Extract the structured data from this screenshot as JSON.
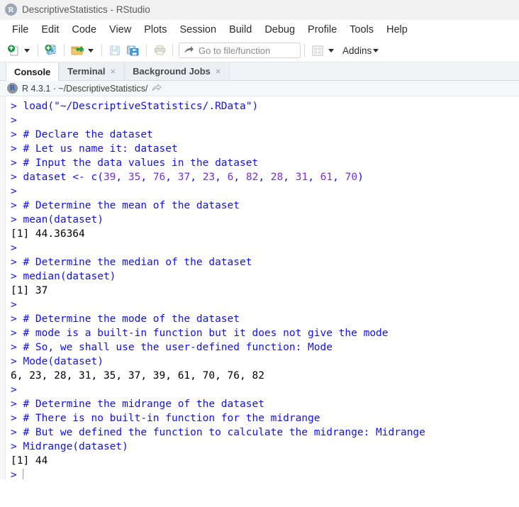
{
  "window": {
    "title": "DescriptiveStatistics - RStudio",
    "logo_letter": "R",
    "logo_icon": "rstudio-logo-icon"
  },
  "menubar": {
    "items": [
      {
        "label": "File"
      },
      {
        "label": "Edit"
      },
      {
        "label": "Code"
      },
      {
        "label": "View"
      },
      {
        "label": "Plots"
      },
      {
        "label": "Session"
      },
      {
        "label": "Build"
      },
      {
        "label": "Debug"
      },
      {
        "label": "Profile"
      },
      {
        "label": "Tools"
      },
      {
        "label": "Help"
      }
    ]
  },
  "toolbar": {
    "new_file_icon": "new-file-icon",
    "new_file_dropdown": "chevron-down-icon",
    "new_project_icon": "new-project-icon",
    "open_file_icon": "open-folder-icon",
    "open_file_dropdown": "chevron-down-icon",
    "save_icon": "save-icon",
    "save_all_icon": "save-all-icon",
    "print_icon": "print-icon",
    "goto_icon": "goto-arrow-icon",
    "goto_placeholder": "Go to file/function",
    "panes_icon": "workspace-panes-icon",
    "panes_dropdown": "chevron-down-icon",
    "addins_label": "Addins",
    "addins_dropdown": "chevron-down-icon"
  },
  "tabs": [
    {
      "label": "Console",
      "active": true,
      "closable": false,
      "close_glyph": ""
    },
    {
      "label": "Terminal",
      "active": false,
      "closable": true,
      "close_glyph": "×"
    },
    {
      "label": "Background Jobs",
      "active": false,
      "closable": true,
      "close_glyph": "×"
    }
  ],
  "session": {
    "badge_letter": "R",
    "text": "R 4.3.1  ·  ~/DescriptiveStatistics/",
    "arrow_icon": "open-in-new-window-icon"
  },
  "console": {
    "prompt": "> ",
    "cursor": "text-cursor",
    "lines": [
      {
        "type": "input",
        "segments": [
          {
            "t": "> load(\"~/DescriptiveStatistics/.RData\")",
            "k": "in"
          }
        ]
      },
      {
        "type": "input",
        "segments": [
          {
            "t": "> ",
            "k": "in"
          }
        ]
      },
      {
        "type": "input",
        "segments": [
          {
            "t": "> # Declare the dataset",
            "k": "in"
          }
        ]
      },
      {
        "type": "input",
        "segments": [
          {
            "t": "> # Let us name it: dataset",
            "k": "in"
          }
        ]
      },
      {
        "type": "input",
        "segments": [
          {
            "t": "> # Input the data values in the dataset",
            "k": "in"
          }
        ]
      },
      {
        "type": "input",
        "segments": [
          {
            "t": "> dataset <- c(",
            "k": "in"
          },
          {
            "t": "39",
            "k": "num"
          },
          {
            "t": ", ",
            "k": "in"
          },
          {
            "t": "35",
            "k": "num"
          },
          {
            "t": ", ",
            "k": "in"
          },
          {
            "t": "76",
            "k": "num"
          },
          {
            "t": ", ",
            "k": "in"
          },
          {
            "t": "37",
            "k": "num"
          },
          {
            "t": ", ",
            "k": "in"
          },
          {
            "t": "23",
            "k": "num"
          },
          {
            "t": ", ",
            "k": "in"
          },
          {
            "t": "6",
            "k": "num"
          },
          {
            "t": ", ",
            "k": "in"
          },
          {
            "t": "82",
            "k": "num"
          },
          {
            "t": ", ",
            "k": "in"
          },
          {
            "t": "28",
            "k": "num"
          },
          {
            "t": ", ",
            "k": "in"
          },
          {
            "t": "31",
            "k": "num"
          },
          {
            "t": ", ",
            "k": "in"
          },
          {
            "t": "61",
            "k": "num"
          },
          {
            "t": ", ",
            "k": "in"
          },
          {
            "t": "70",
            "k": "num"
          },
          {
            "t": ")",
            "k": "in"
          }
        ]
      },
      {
        "type": "input",
        "segments": [
          {
            "t": "> ",
            "k": "in"
          }
        ]
      },
      {
        "type": "input",
        "segments": [
          {
            "t": "> # Determine the mean of the dataset",
            "k": "in"
          }
        ]
      },
      {
        "type": "input",
        "segments": [
          {
            "t": "> mean(dataset)",
            "k": "in"
          }
        ]
      },
      {
        "type": "output",
        "segments": [
          {
            "t": "[1] 44.36364",
            "k": "out"
          }
        ]
      },
      {
        "type": "input",
        "segments": [
          {
            "t": "> ",
            "k": "in"
          }
        ]
      },
      {
        "type": "input",
        "segments": [
          {
            "t": "> # Determine the median of the dataset",
            "k": "in"
          }
        ]
      },
      {
        "type": "input",
        "segments": [
          {
            "t": "> median(dataset)",
            "k": "in"
          }
        ]
      },
      {
        "type": "output",
        "segments": [
          {
            "t": "[1] 37",
            "k": "out"
          }
        ]
      },
      {
        "type": "input",
        "segments": [
          {
            "t": "> ",
            "k": "in"
          }
        ]
      },
      {
        "type": "input",
        "segments": [
          {
            "t": "> # Determine the mode of the dataset",
            "k": "in"
          }
        ]
      },
      {
        "type": "input",
        "segments": [
          {
            "t": "> # mode is a built-in function but it does not give the mode",
            "k": "in"
          }
        ]
      },
      {
        "type": "input",
        "segments": [
          {
            "t": "> # So, we shall use the user-defined function: Mode",
            "k": "in"
          }
        ]
      },
      {
        "type": "input",
        "segments": [
          {
            "t": "> Mode(dataset)",
            "k": "in"
          }
        ]
      },
      {
        "type": "output",
        "segments": [
          {
            "t": "6, 23, 28, 31, 35, 37, 39, 61, 70, 76, 82",
            "k": "out"
          }
        ]
      },
      {
        "type": "input",
        "segments": [
          {
            "t": "> ",
            "k": "in"
          }
        ]
      },
      {
        "type": "input",
        "segments": [
          {
            "t": "> # Determine the midrange of the dataset",
            "k": "in"
          }
        ]
      },
      {
        "type": "input",
        "segments": [
          {
            "t": "> # There is no built-in function for the midrange",
            "k": "in"
          }
        ]
      },
      {
        "type": "input",
        "segments": [
          {
            "t": "> # But we defined the function to calculate the midrange: Midrange",
            "k": "in"
          }
        ]
      },
      {
        "type": "input",
        "segments": [
          {
            "t": "> Midrange(dataset)",
            "k": "in"
          }
        ]
      },
      {
        "type": "output",
        "segments": [
          {
            "t": "[1] 44",
            "k": "out"
          }
        ]
      },
      {
        "type": "prompt",
        "segments": [
          {
            "t": "> ",
            "k": "in"
          }
        ]
      }
    ]
  },
  "colors": {
    "input_blue": "#1111ee",
    "output_black": "#000000",
    "number_violet": "#7a2ee0",
    "titlebar_bg": "#f1f1f1",
    "tabbar_bg": "#f0f4f6",
    "console_bg": "#ffffff"
  }
}
